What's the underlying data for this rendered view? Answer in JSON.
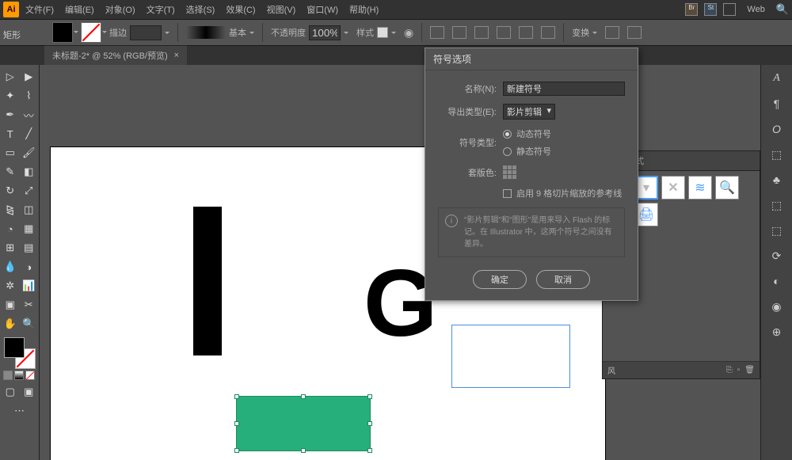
{
  "app": {
    "icon": "Ai"
  },
  "menu": {
    "file": "文件(F)",
    "edit": "编辑(E)",
    "object": "对象(O)",
    "type": "文字(T)",
    "select": "选择(S)",
    "effect": "效果(C)",
    "view": "视图(V)",
    "window": "窗口(W)",
    "help": "帮助(H)",
    "workspace": "Web"
  },
  "options": {
    "shape_label": "矩形",
    "stroke_label": "描边",
    "stroke_val": "",
    "brush_label": "基本",
    "opacity_label": "不透明度",
    "opacity_val": "100%",
    "style_label": "样式",
    "transform_label": "变换"
  },
  "tab": {
    "title": "未标题-2* @ 52% (RGB/预览)"
  },
  "canvas": {
    "letter1": "I",
    "letter2": "G"
  },
  "panel": {
    "graphic_styles": "图形样式",
    "footer": "风"
  },
  "right_col": [
    "A",
    "¶",
    "O",
    "⬚",
    "♣",
    "⬚",
    "⬚",
    "⟳",
    "◐",
    "◉",
    "⊕"
  ],
  "dialog": {
    "title": "符号选项",
    "name_label": "名称(N):",
    "name_val": "新建符号",
    "export_label": "导出类型(E):",
    "export_val": "影片剪辑",
    "type_label": "符号类型:",
    "type_movie": "动态符号",
    "type_graphic": "静态符号",
    "reg_label": "套版色:",
    "slice_label": "启用 9 格切片缩放的参考线",
    "info": "\"影片剪辑\"和\"图形\"是用来导入 Flash 的标记。在 Illustrator 中，这两个符号之间没有差异。",
    "ok": "确定",
    "cancel": "取消"
  }
}
